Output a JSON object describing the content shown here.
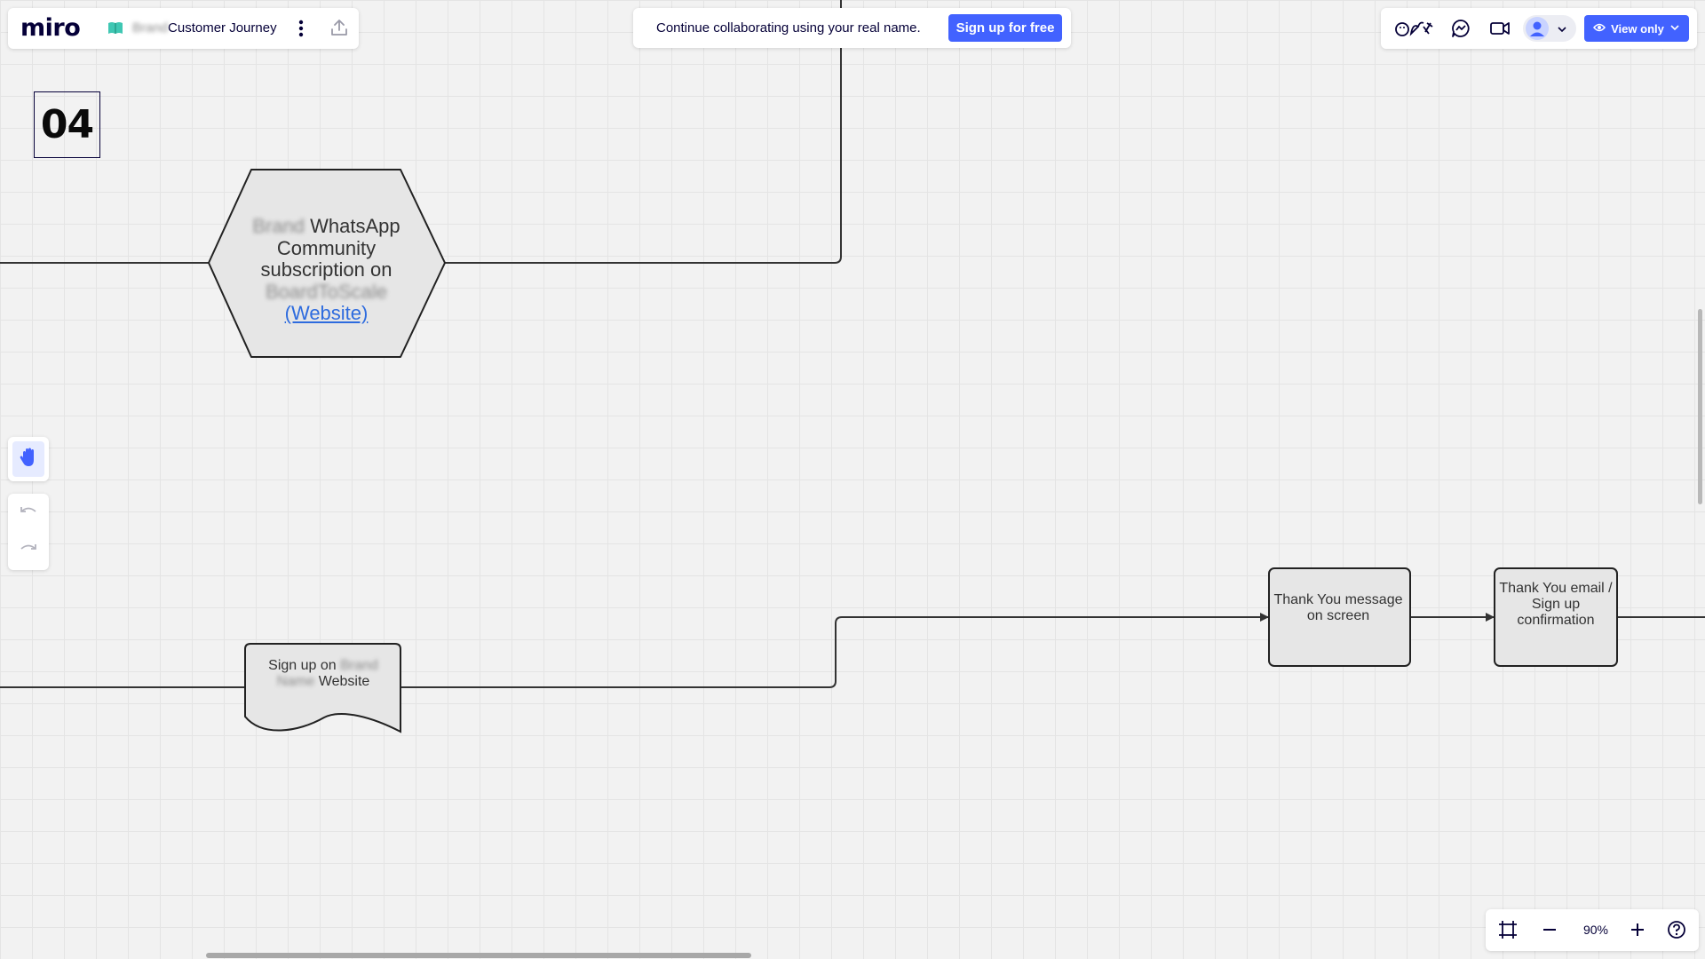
{
  "app": {
    "logo": "miro"
  },
  "board": {
    "name_blurred": "Brand",
    "name": "Customer Journey"
  },
  "banner": {
    "text": "Continue collaborating using your real name.",
    "signup_label": "Sign up for free"
  },
  "header_right": {
    "view_only_label": "View only"
  },
  "frame": {
    "number": "04"
  },
  "canvas": {
    "hexagon": {
      "blur_1": "Brand",
      "line_1": " WhatsApp Community subscription on ",
      "blur_2": "BoardToScale",
      "link": "(Website)"
    },
    "document": {
      "line_1": "Sign up on ",
      "blur_1": "Brand",
      "blur_2": "Name",
      "line_2": " Website"
    },
    "box_1": {
      "text": "Thank You message on screen"
    },
    "box_2": {
      "text": "Thank You email / Sign up confirmation"
    }
  },
  "zoom": {
    "level": "90%"
  },
  "icons": [
    "board-icon",
    "more-vertical-icon",
    "upload-icon",
    "reactions-icon",
    "chat-icon",
    "video-icon",
    "avatar-icon",
    "chevron-down-icon",
    "eye-icon",
    "hand-icon",
    "undo-icon",
    "redo-icon",
    "fit-frame-icon",
    "zoom-out-icon",
    "zoom-in-icon",
    "help-icon"
  ],
  "colors": {
    "accent": "#4262ff",
    "link": "#2d6bde",
    "canvas": "#f2f2f2",
    "text": "#050038"
  }
}
